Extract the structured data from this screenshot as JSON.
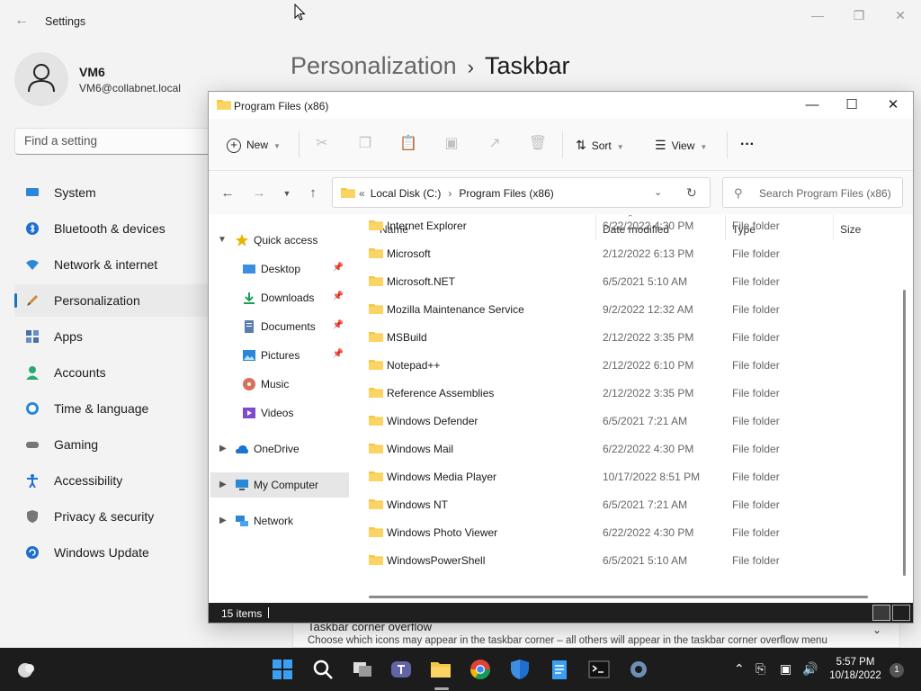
{
  "settings": {
    "title": "Settings",
    "user": {
      "name": "VM6",
      "email": "VM6@collabnet.local"
    },
    "search_placeholder": "Find a setting",
    "nav": [
      {
        "label": "System",
        "icon": "monitor-icon"
      },
      {
        "label": "Bluetooth & devices",
        "icon": "bluetooth-icon"
      },
      {
        "label": "Network & internet",
        "icon": "wifi-icon"
      },
      {
        "label": "Personalization",
        "icon": "brush-icon",
        "active": true
      },
      {
        "label": "Apps",
        "icon": "apps-icon"
      },
      {
        "label": "Accounts",
        "icon": "person-icon"
      },
      {
        "label": "Time & language",
        "icon": "clock-globe-icon"
      },
      {
        "label": "Gaming",
        "icon": "gamepad-icon"
      },
      {
        "label": "Accessibility",
        "icon": "accessibility-icon"
      },
      {
        "label": "Privacy & security",
        "icon": "shield-icon"
      },
      {
        "label": "Windows Update",
        "icon": "update-icon"
      }
    ],
    "breadcrumb": {
      "parent": "Personalization",
      "separator": "›",
      "current": "Taskbar"
    },
    "overflow_card": {
      "title": "Taskbar corner overflow",
      "description": "Choose which icons may appear in the taskbar corner – all others will appear in the taskbar corner overflow menu"
    }
  },
  "explorer": {
    "title": "Program Files (x86)",
    "toolbar": {
      "new_label": "New",
      "sort_label": "Sort",
      "view_label": "View",
      "more_label": "···"
    },
    "address": {
      "prefix": "«",
      "path": [
        "Local Disk (C:)",
        "Program Files (x86)"
      ],
      "separator": "›"
    },
    "search_placeholder": "Search Program Files (x86)",
    "nav_pane": [
      {
        "label": "Quick access",
        "type": "quick",
        "expanded": true,
        "indent": 0
      },
      {
        "label": "Desktop",
        "type": "desktop",
        "pinned": true,
        "indent": 1
      },
      {
        "label": "Downloads",
        "type": "downloads",
        "pinned": true,
        "indent": 1
      },
      {
        "label": "Documents",
        "type": "documents",
        "pinned": true,
        "indent": 1
      },
      {
        "label": "Pictures",
        "type": "pictures",
        "pinned": true,
        "indent": 1
      },
      {
        "label": "Music",
        "type": "music",
        "pinned": false,
        "indent": 1
      },
      {
        "label": "Videos",
        "type": "videos",
        "pinned": false,
        "indent": 1
      },
      {
        "label": "OneDrive",
        "type": "onedrive",
        "expanded": false,
        "indent": 0
      },
      {
        "label": "My Computer",
        "type": "computer",
        "expanded": false,
        "indent": 0,
        "selected": true
      },
      {
        "label": "Network",
        "type": "network",
        "expanded": false,
        "indent": 0
      }
    ],
    "columns": {
      "name": "Name",
      "date": "Date modified",
      "type": "Type",
      "size": "Size"
    },
    "files": [
      {
        "name": "Internet Explorer",
        "date": "6/22/2022 4:30 PM",
        "type": "File folder"
      },
      {
        "name": "Microsoft",
        "date": "2/12/2022 6:13 PM",
        "type": "File folder"
      },
      {
        "name": "Microsoft.NET",
        "date": "6/5/2021 5:10 AM",
        "type": "File folder"
      },
      {
        "name": "Mozilla Maintenance Service",
        "date": "9/2/2022 12:32 AM",
        "type": "File folder"
      },
      {
        "name": "MSBuild",
        "date": "2/12/2022 3:35 PM",
        "type": "File folder"
      },
      {
        "name": "Notepad++",
        "date": "2/12/2022 6:10 PM",
        "type": "File folder"
      },
      {
        "name": "Reference Assemblies",
        "date": "2/12/2022 3:35 PM",
        "type": "File folder"
      },
      {
        "name": "Windows Defender",
        "date": "6/5/2021 7:21 AM",
        "type": "File folder"
      },
      {
        "name": "Windows Mail",
        "date": "6/22/2022 4:30 PM",
        "type": "File folder"
      },
      {
        "name": "Windows Media Player",
        "date": "10/17/2022 8:51 PM",
        "type": "File folder"
      },
      {
        "name": "Windows NT",
        "date": "6/5/2021 7:21 AM",
        "type": "File folder"
      },
      {
        "name": "Windows Photo Viewer",
        "date": "6/22/2022 4:30 PM",
        "type": "File folder"
      },
      {
        "name": "WindowsPowerShell",
        "date": "6/5/2021 5:10 AM",
        "type": "File folder"
      }
    ],
    "status": {
      "item_count": "15 items"
    }
  },
  "taskbar": {
    "apps": [
      "start-icon",
      "search-icon",
      "task-view-icon",
      "teams-icon",
      "file-explorer-icon",
      "chrome-icon",
      "defender-icon",
      "notepad-icon",
      "terminal-icon",
      "settings-icon"
    ],
    "clock": {
      "time": "5:57 PM",
      "date": "10/18/2022"
    },
    "notification_count": "1"
  },
  "colors": {
    "accent": "#1a73b8",
    "folder": "#f6c744",
    "taskbar": "#1c1c1c",
    "status_bar": "#1f1f1f"
  }
}
